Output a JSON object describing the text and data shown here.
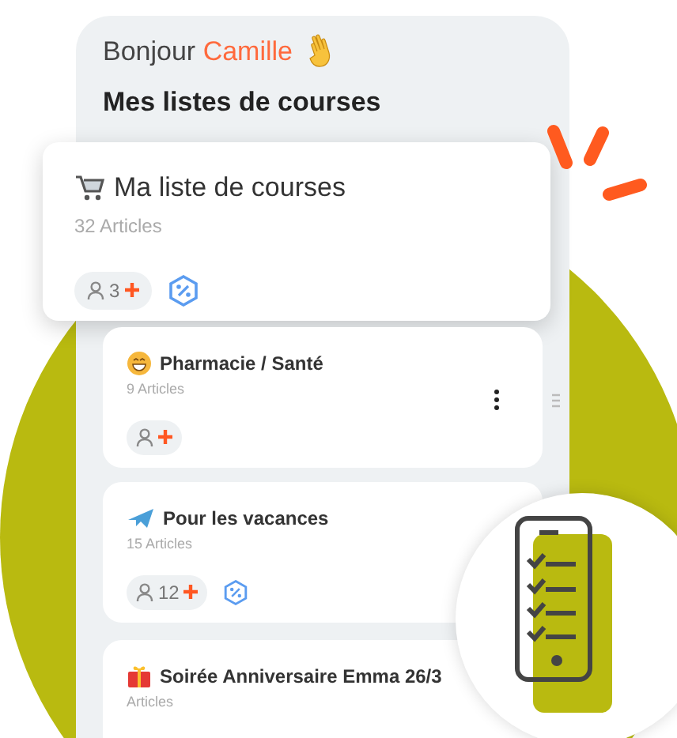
{
  "greeting": {
    "prefix": "Bonjour",
    "name": "Camille"
  },
  "title": "Mes listes de courses",
  "lists": [
    {
      "kind": "cart",
      "title": "Ma liste de courses",
      "count": "32 Articles",
      "members_chip": true,
      "members": "3",
      "promo": true,
      "actions": false
    },
    {
      "kind": "health",
      "title": "Pharmacie / Santé",
      "count": "9 Articles",
      "members_chip": true,
      "promo": false,
      "actions": true
    },
    {
      "kind": "travel",
      "title": "Pour les vacances",
      "count": "15 Articles",
      "members_chip": true,
      "members": "12",
      "promo": true,
      "actions": false
    },
    {
      "kind": "party",
      "title": "Soirée Anniversaire Emma 26/3",
      "count": "Articles"
    }
  ]
}
